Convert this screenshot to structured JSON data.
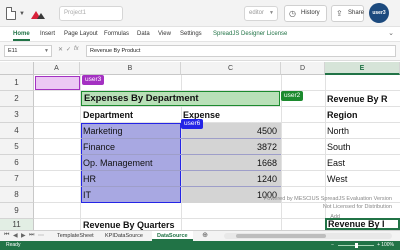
{
  "topbar": {
    "workbook_name_placeholder": "Project1",
    "user_select": "editor",
    "history_label": "History",
    "share_label": "Share",
    "avatar_text": "user3"
  },
  "ribbon": {
    "tabs": [
      "Home",
      "Insert",
      "Page Layout",
      "Formulas",
      "Data",
      "View",
      "Settings",
      "SpreadJS Designer License"
    ],
    "active_tab": "Home"
  },
  "formula_bar": {
    "cell_ref": "E11",
    "cancel_symbol": "✕",
    "confirm_symbol": "✓",
    "fx_symbol": "fx",
    "formula": "Revenue By Product"
  },
  "grid": {
    "columns": [
      "A",
      "B",
      "C",
      "D",
      "E"
    ],
    "rows": [
      "1",
      "2",
      "3",
      "4",
      "5",
      "6",
      "7",
      "8",
      "9",
      "10",
      "11"
    ],
    "selected_column": "E",
    "cells": {
      "title": "Expenses By Department",
      "header_department": "Department",
      "header_expense": "Expense",
      "departments": [
        "Marketing",
        "Finance",
        "Op. Management",
        "HR",
        "IT"
      ],
      "expenses": [
        "4500",
        "3872",
        "1668",
        "1240",
        "1000"
      ],
      "e2": "Revenue By R",
      "e3": "Region",
      "regions": [
        "North",
        "South",
        "East",
        "West"
      ],
      "b11": "Revenue By Quarters",
      "e11": "Revenue By I"
    },
    "tags": {
      "user3": "user3",
      "user2": "user2",
      "user6": "user6"
    },
    "tag_colors": {
      "user3": "#a431c2",
      "user2": "#1c8a2e",
      "user6": "#2424e6"
    },
    "watermark_line1": "Powered by MESCIUS SpreadJS Evaluation Version",
    "watermark_line2": "Not Licensed for Distribution",
    "watermark_line3": "Add"
  },
  "sheets": {
    "tabs": [
      "TemplateSheet",
      "KPIDataSource",
      "DataSource"
    ],
    "active": "DataSource"
  },
  "status": {
    "ready": "Ready",
    "zoom": "100%",
    "zoom_minus": "−",
    "zoom_plus": "+"
  },
  "colors": {
    "accent": "#217346",
    "title_fill": "#b9e0b8",
    "range_fill": "#a8a8e2",
    "gray_fill": "#cfcfcf"
  }
}
